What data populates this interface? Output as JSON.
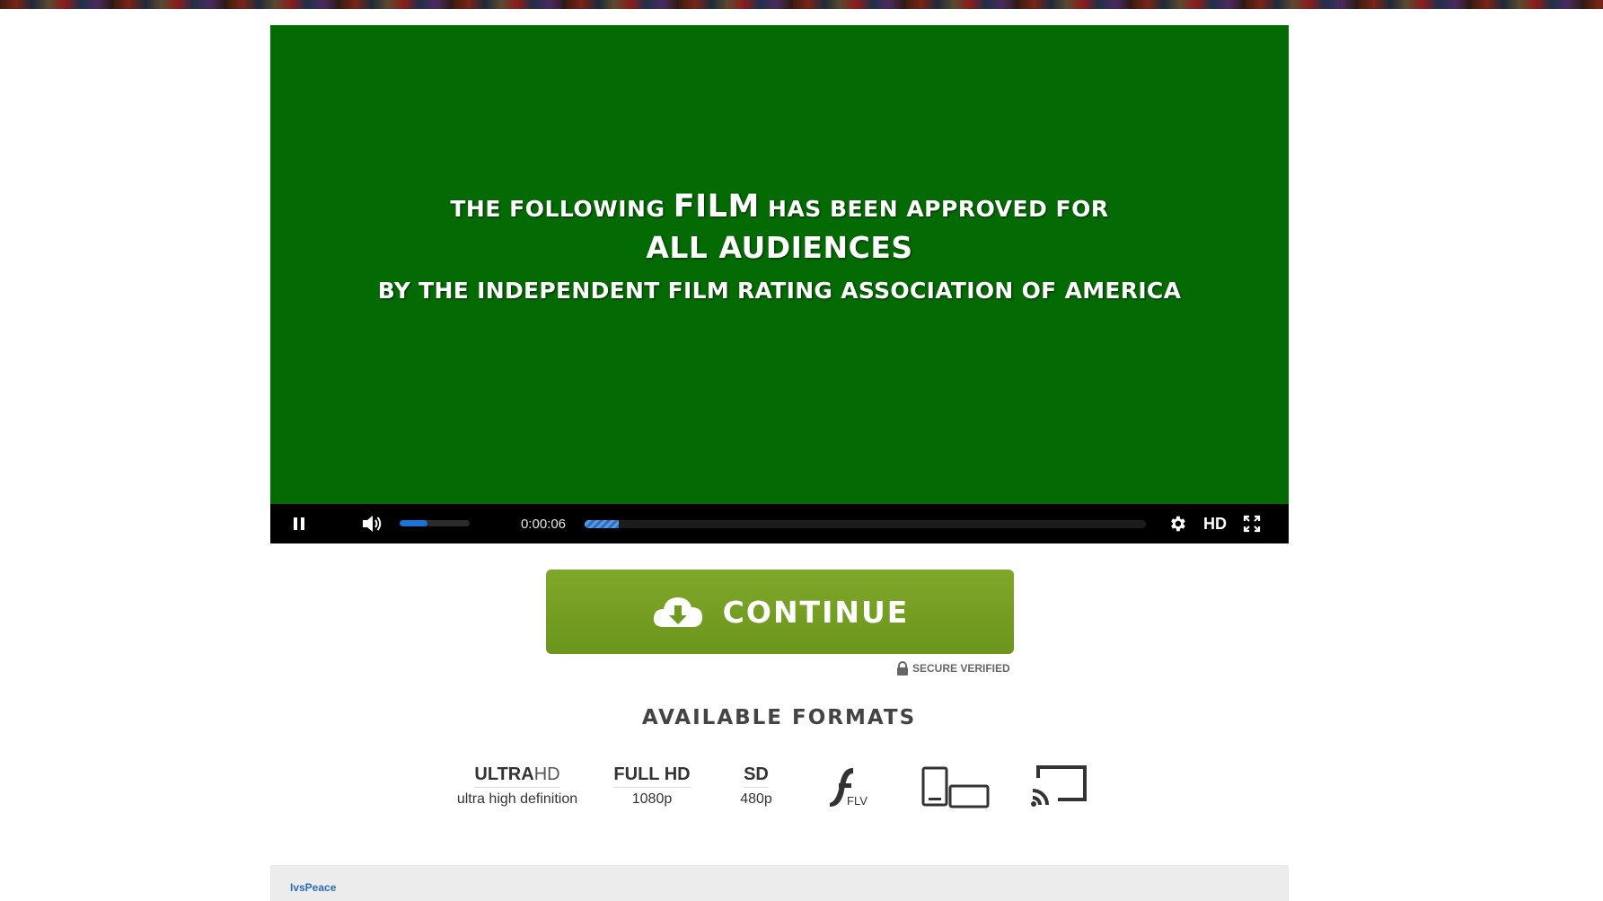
{
  "banner": {
    "icon": "movie-posters-strip"
  },
  "player": {
    "rating_card": {
      "line1_prefix": "THE FOLLOWING",
      "line1_emphasis": "FILM",
      "line1_suffix": "HAS BEEN APPROVED FOR",
      "line2": "ALL AUDIENCES",
      "line3": "BY THE INDEPENDENT FILM RATING ASSOCIATION OF AMERICA",
      "background_color": "#046a04"
    },
    "controls": {
      "pause_icon": "pause-icon",
      "volume_icon": "volume-icon",
      "volume_level_percent": 40,
      "time": "0:00:06",
      "progress_buffer_percent": 6,
      "settings_icon": "gear-icon",
      "quality_label": "HD",
      "fullscreen_icon": "fullscreen-icon",
      "accent_color": "#1a73d9"
    }
  },
  "cta": {
    "label": "CONTINUE",
    "icon": "cloud-download-icon",
    "color": "#76a023"
  },
  "secure": {
    "label": "SECURE VERIFIED",
    "icon": "lock-icon"
  },
  "formats": {
    "heading": "AVAILABLE FORMATS",
    "items": [
      {
        "name_bold": "ULTRA",
        "name_light": "HD",
        "sub": "ultra high definition"
      },
      {
        "name": "FULL HD",
        "sub": "1080p"
      },
      {
        "name": "SD",
        "sub": "480p"
      },
      {
        "icon": "flash-flv-icon",
        "label": "FLV"
      },
      {
        "icon": "devices-icon"
      },
      {
        "icon": "cast-icon"
      }
    ]
  },
  "comments": {
    "author": "IvsPeace"
  }
}
